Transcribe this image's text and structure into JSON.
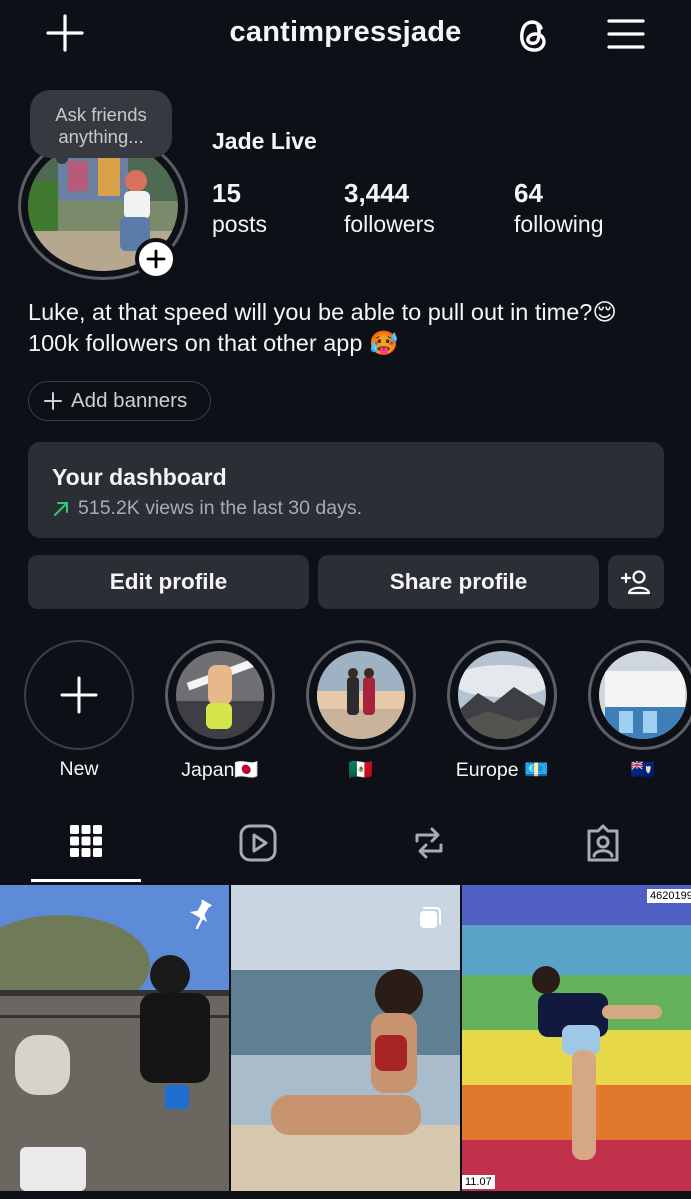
{
  "header": {
    "username": "cantimpressjade",
    "icons": [
      "plus-icon",
      "threads-icon",
      "hamburger-menu-icon"
    ]
  },
  "profile": {
    "note": "Ask friends anything...",
    "display_name": "Jade Live",
    "stats": [
      {
        "value": "15",
        "label": "posts"
      },
      {
        "value": "3,444",
        "label": "followers"
      },
      {
        "value": "64",
        "label": "following"
      }
    ],
    "bio_line1": "Luke, at that speed will you be able to pull out in time?😌",
    "bio_line2": "100k followers on that other app 🥵",
    "add_banners": "Add banners"
  },
  "dashboard": {
    "title": "Your dashboard",
    "subtitle": "515.2K views in the last 30 days."
  },
  "actions": {
    "edit": "Edit profile",
    "share": "Share profile"
  },
  "highlights": [
    {
      "label": "New"
    },
    {
      "label": "Japan🇯🇵"
    },
    {
      "label": "🇲🇽"
    },
    {
      "label": "Europe 💶"
    },
    {
      "label": "🇦🇮"
    }
  ],
  "tabs": [
    "grid-icon",
    "reels-icon",
    "reposts-icon",
    "tagged-icon"
  ],
  "grid_tags": {
    "top_right": "4620199",
    "bottom_left": "11.07"
  },
  "colors": {
    "background": "#0d1117",
    "card": "#2b2f35",
    "accent_green": "#2ecc71"
  }
}
